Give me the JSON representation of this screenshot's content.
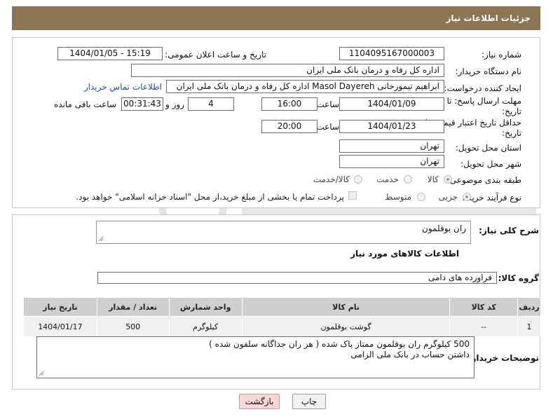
{
  "header": {
    "title": "جزئیات اطلاعات نیاز"
  },
  "details": {
    "need_number_label": "شماره نیاز:",
    "need_number": "1104095167000003",
    "announce_label": "تاریخ و ساعت اعلان عمومی:",
    "announce_value": "1404/01/05 - 15:19",
    "buyer_org_label": "نام دستگاه خریدار:",
    "buyer_org": "اداره کل رفاه و درمان بانک ملی ایران",
    "creator_label": "ایجاد کننده درخواست:",
    "creator": "ابراهیم تیمورخانی Masol Dayereh اداره کل رفاه و درمان بانک ملی ایران",
    "contact_link": "اطلاعات تماس خریدار",
    "deadline_label_1": "مهلت ارسال پاسخ: تا",
    "deadline_label_2": "تاریخ:",
    "deadline_date": "1404/01/09",
    "time_label": "ساعت",
    "deadline_time": "16:00",
    "days_value": "4",
    "days_label": "روز و",
    "remaining_value": "00:31:43",
    "remaining_label": "ساعت باقی مانده",
    "validity_label_1": "حداقل تاریخ اعتبار قیمت: تا",
    "validity_label_2": "تاریخ:",
    "validity_date": "1404/01/23",
    "validity_time": "20:00",
    "province_label": "استان محل تحویل:",
    "province": "تهران",
    "city_label": "شهر محل تحویل:",
    "city": "تهران",
    "category_label": "طبقه بندی موضوعی:",
    "category_options": [
      "کالا",
      "خدمت",
      "کالا/خدمت"
    ],
    "process_label": "نوع فرآیند خرید :",
    "process_options": [
      "جزیی",
      "متوسط"
    ],
    "payment_note": "پرداخت تمام یا بخشی از مبلغ خرید،از محل \"اسناد خزانه اسلامی\" خواهد بود."
  },
  "summary": {
    "label": "شرح کلی نیاز:",
    "value": "ران بوقلمون",
    "goods_info_title": "اطلاعات کالاهای مورد نیاز",
    "group_label": "گروه کالا:",
    "group_value": "فراورده های دامی"
  },
  "table": {
    "columns": [
      "ردیف",
      "کد کالا",
      "نام کالا",
      "واحد شمارش",
      "تعداد / مقدار",
      "تاریخ نیاز"
    ],
    "rows": [
      [
        "1",
        "--",
        "گوشت بوقلمون",
        "کیلوگرم",
        "500",
        "1404/01/17"
      ]
    ]
  },
  "buyer_notes": {
    "label": "توضیحات خریدار:",
    "line1": "500 کیلوگرم ران بوقلمون ممتاز پاک شده ( هر ران جداگانه سلفون شده )",
    "line2": "داشتن حساب در بانک ملی الزامی"
  },
  "buttons": {
    "print": "چاپ",
    "back": "بازگشت"
  },
  "colors": {
    "header_bg": "#8c7553",
    "link": "#1a4fb0",
    "back_btn_bg": "#f7d7d7"
  }
}
